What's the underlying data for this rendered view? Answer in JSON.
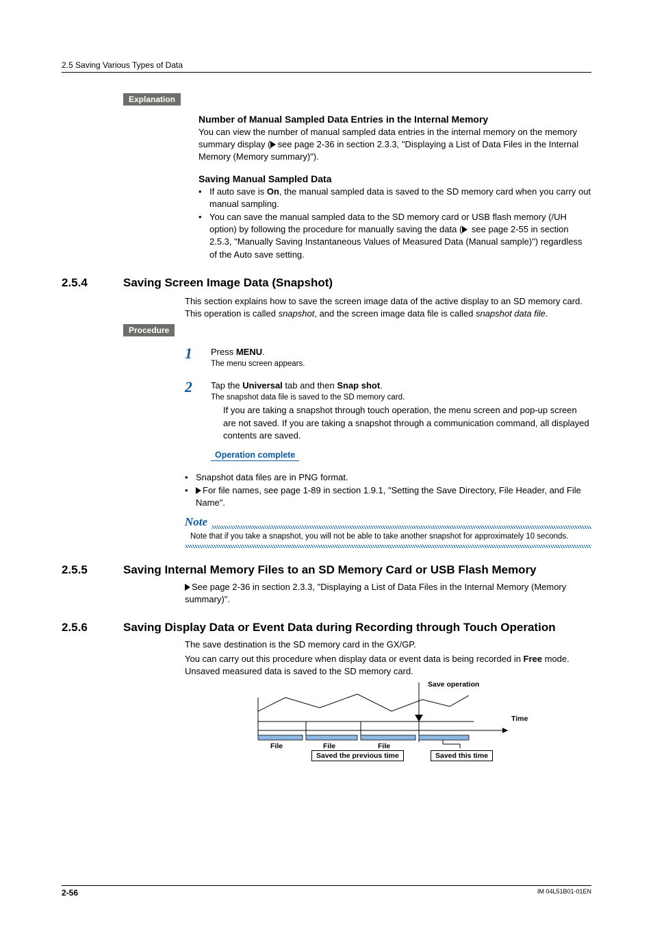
{
  "runningHeader": "2.5  Saving Various Types of Data",
  "labels": {
    "explanation": "Explanation",
    "procedure": "Procedure"
  },
  "explanation": {
    "head1": "Number of Manual Sampled Data Entries in the Internal Memory",
    "para1a": "You can view the number of manual sampled data entries in the internal memory on the memory summary display (",
    "para1b": "see page 2-36 in section 2.3.3, \"Displaying a List of Data Files in the Internal Memory (Memory summary)\").",
    "head2": "Saving Manual Sampled Data",
    "b1a": "If auto save is ",
    "b1bold": "On",
    "b1b": ", the manual sampled data is saved to the SD memory card when you carry out manual sampling.",
    "b2a": "You can save the manual sampled data to the SD memory card or USB flash memory (/UH option) by following the procedure for manually saving the data (",
    "b2b": " see page 2-55 in section 2.5.3, \"Manually Saving Instantaneous Values of Measured Data (Manual sample)\") regardless of the Auto save setting."
  },
  "s254": {
    "num": "2.5.4",
    "title": "Saving Screen Image Data (Snapshot)",
    "introA": "This section explains how to save the screen image data of the active display to an SD memory card. This operation is called ",
    "introItal1": "snapshot",
    "introB": ", and the screen image data file is called ",
    "introItal2": "snapshot data file",
    "introC": ".",
    "step1a": "Press ",
    "step1bold": "MENU",
    "step1b": ".",
    "step1sub": "The menu screen appears.",
    "step2a": "Tap the ",
    "step2bold1": "Universal",
    "step2b": " tab and then ",
    "step2bold2": "Snap shot",
    "step2c": ".",
    "step2sub": "The snapshot data file is saved to the SD memory card.",
    "step2ind": "If you are taking a snapshot through touch operation, the menu screen and pop-up screen are not saved. If you are taking a snapshot through a communication command, all displayed contents are saved.",
    "opComplete": "Operation complete",
    "bul1": "Snapshot data files are in PNG format.",
    "bul2": "For file names, see page 1-89 in section 1.9.1, \"Setting the Save Directory, File Header, and File Name\".",
    "noteLabel": "Note",
    "noteText": "Note that if you take a snapshot, you will not be able to take another snapshot for approximately 10 seconds."
  },
  "s255": {
    "num": "2.5.5",
    "title": "Saving Internal Memory Files to an SD Memory Card or USB Flash Memory",
    "text": "See page 2-36 in section 2.3.3, \"Displaying a List of Data Files in the Internal Memory (Memory summary)\"."
  },
  "s256": {
    "num": "2.5.6",
    "title": "Saving Display Data or Event Data during Recording through Touch Operation",
    "p1": "The save destination is the SD memory card in the GX/GP.",
    "p2a": "You can carry out this procedure when display data or event data is being recorded in ",
    "p2bold": "Free",
    "p2b": " mode. Unsaved measured data is saved to the SD memory card."
  },
  "diagram": {
    "saveOp": "Save operation",
    "time": "Time",
    "file": "File",
    "savedPrev": "Saved the previous time",
    "savedThis": "Saved this time"
  },
  "footer": {
    "page": "2-56",
    "doc": "IM 04L51B01-01EN"
  }
}
